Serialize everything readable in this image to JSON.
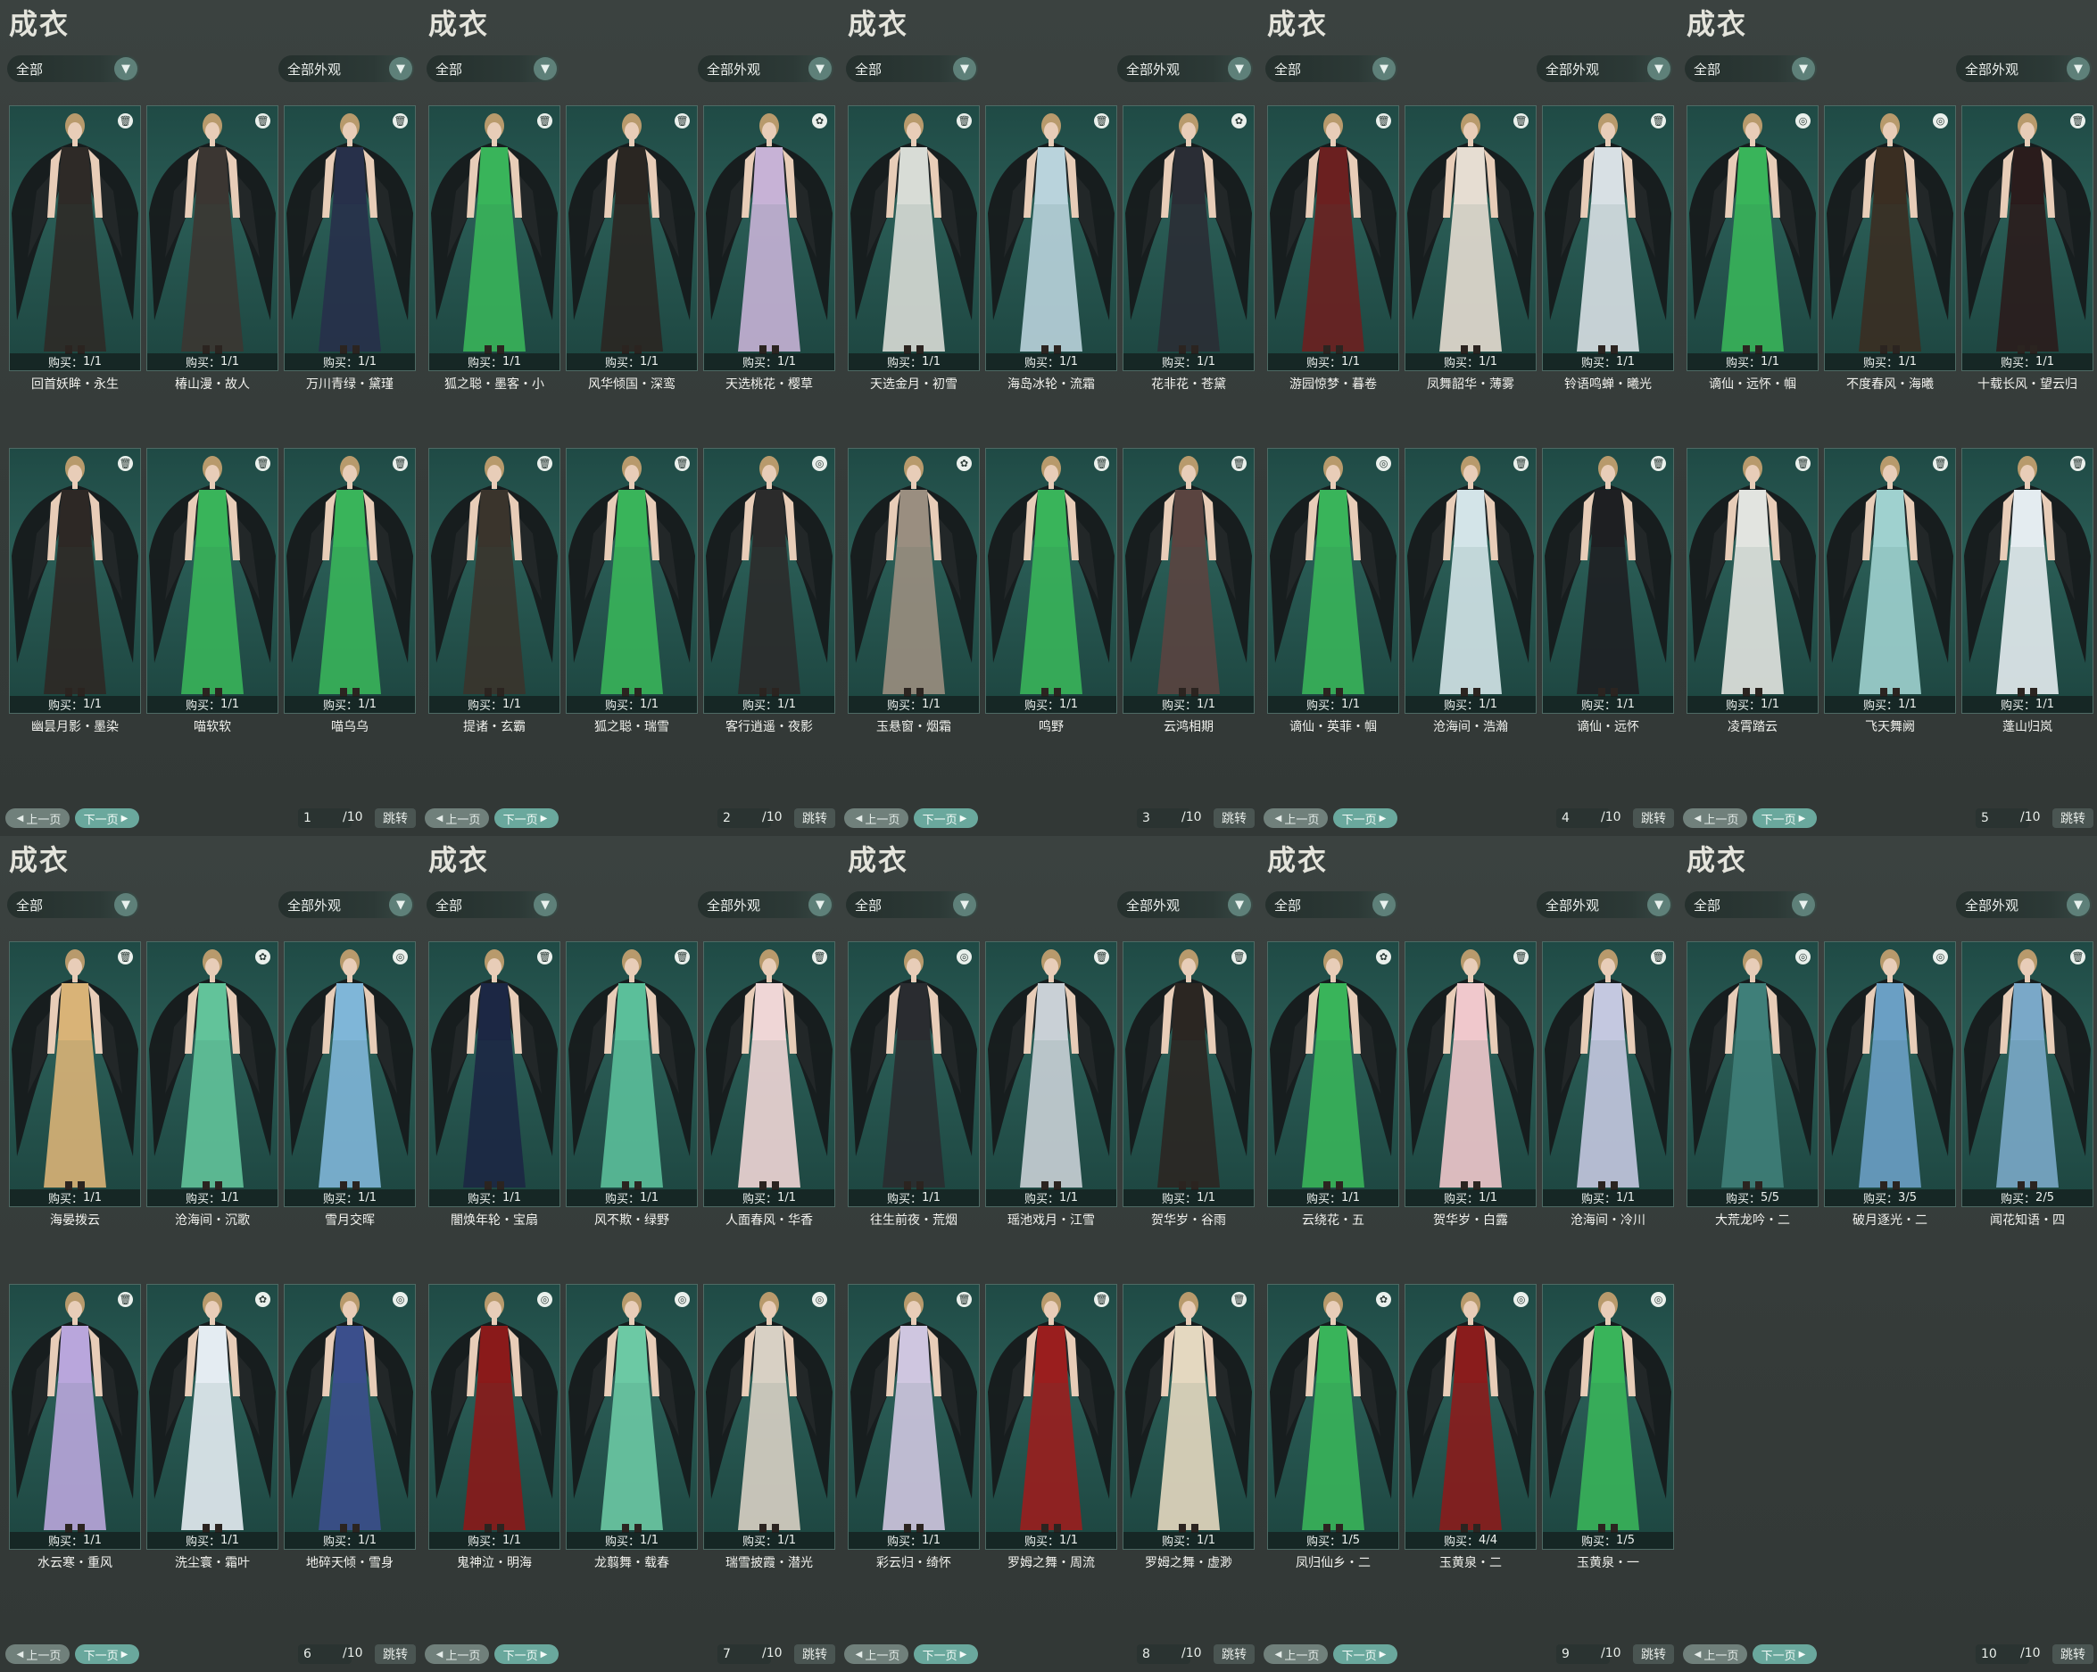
{
  "panel_title": "成衣",
  "filter_left": "全部",
  "filter_right": "全部外观",
  "buy_prefix": "购买：",
  "prev_label": "上一页",
  "next_label": "下一页",
  "jump_label": "跳转",
  "page_total": "/10",
  "icons": {
    "dropdown": "chevron-down-icon",
    "delete": "trash-icon",
    "butterfly": "butterfly-icon",
    "ring": "ring-icon",
    "prev": "arrow-left-icon",
    "next": "arrow-right-icon"
  },
  "colors": {
    "background": "#353c3a",
    "card_bg": "#2a5c55",
    "next_button": "#6aa89d",
    "prev_button": "#70807b",
    "dropdown_chevron": "#5e8079"
  },
  "panels": [
    {
      "page": "1",
      "items": [
        {
          "name": "回首妖眸・永生",
          "buy": "1/1",
          "badge": "delete",
          "outfit": "#2e2a27"
        },
        {
          "name": "椿山漫・故人",
          "buy": "1/1",
          "badge": "delete",
          "outfit": "#3b3632"
        },
        {
          "name": "万川青绿・黛瑾",
          "buy": "1/1",
          "badge": "delete",
          "outfit": "#27304a"
        },
        {
          "name": "幽昙月影・墨染",
          "buy": "1/1",
          "badge": "delete",
          "outfit": "#2d2825"
        },
        {
          "name": "喵软软",
          "buy": "1/1",
          "badge": "delete",
          "outfit": "#39b45a"
        },
        {
          "name": "喵乌乌",
          "buy": "1/1",
          "badge": "delete",
          "outfit": "#39b45a"
        }
      ]
    },
    {
      "page": "2",
      "items": [
        {
          "name": "狐之聪・墨客・小",
          "buy": "1/1",
          "badge": "delete",
          "outfit": "#39b45a"
        },
        {
          "name": "风华倾国・深鸾",
          "buy": "1/1",
          "badge": "delete",
          "outfit": "#2a2622"
        },
        {
          "name": "天选桃花・樱草",
          "buy": "1/1",
          "badge": "butterfly",
          "outfit": "#c7b2d6"
        },
        {
          "name": "提诸・玄霸",
          "buy": "1/1",
          "badge": "delete",
          "outfit": "#3a342c"
        },
        {
          "name": "狐之聪・瑞雪",
          "buy": "1/1",
          "badge": "delete",
          "outfit": "#39b45a"
        },
        {
          "name": "客行逍遥・夜影",
          "buy": "1/1",
          "badge": "ring",
          "outfit": "#2b2b2b"
        }
      ]
    },
    {
      "page": "3",
      "items": [
        {
          "name": "天选金月・初雪",
          "buy": "1/1",
          "badge": "delete",
          "outfit": "#d8dcd6"
        },
        {
          "name": "海岛冰轮・流霜",
          "buy": "1/1",
          "badge": "delete",
          "outfit": "#b9d3dc"
        },
        {
          "name": "花非花・苍黛",
          "buy": "1/1",
          "badge": "butterfly",
          "outfit": "#2a2d35"
        },
        {
          "name": "玉悬窗・烟霜",
          "buy": "1/1",
          "badge": "butterfly",
          "outfit": "#9a8e80"
        },
        {
          "name": "鸣野",
          "buy": "1/1",
          "badge": "delete",
          "outfit": "#39b45a"
        },
        {
          "name": "云鸿相期",
          "buy": "1/1",
          "badge": "delete",
          "outfit": "#5a4440"
        }
      ]
    },
    {
      "page": "4",
      "items": [
        {
          "name": "游园惊梦・暮卷",
          "buy": "1/1",
          "badge": "delete",
          "outfit": "#6b2020"
        },
        {
          "name": "凤舞韶华・薄雾",
          "buy": "1/1",
          "badge": "delete",
          "outfit": "#e6ddd2"
        },
        {
          "name": "铃语鸣蝉・曦光",
          "buy": "1/1",
          "badge": "delete",
          "outfit": "#d8e0e4"
        },
        {
          "name": "谪仙・英菲・帼",
          "buy": "1/1",
          "badge": "ring",
          "outfit": "#39b45a"
        },
        {
          "name": "沧海间・浩瀚",
          "buy": "1/1",
          "badge": "delete",
          "outfit": "#d3e4e8"
        },
        {
          "name": "谪仙・远怀",
          "buy": "1/1",
          "badge": "delete",
          "outfit": "#1e1f22"
        }
      ]
    },
    {
      "page": "5",
      "items": [
        {
          "name": "谪仙・远怀・帼",
          "buy": "1/1",
          "badge": "ring",
          "outfit": "#39b45a"
        },
        {
          "name": "不度春风・海曦",
          "buy": "1/1",
          "badge": "ring",
          "outfit": "#3a2e22"
        },
        {
          "name": "十载长风・望云归",
          "buy": "1/1",
          "badge": "delete",
          "outfit": "#2a1c1c"
        },
        {
          "name": "凌霄踏云",
          "buy": "1/1",
          "badge": "delete",
          "outfit": "#e2e4e0"
        },
        {
          "name": "飞天舞阙",
          "buy": "1/1",
          "badge": "delete",
          "outfit": "#9fd1cf"
        },
        {
          "name": "蓬山归岚",
          "buy": "1/1",
          "badge": "delete",
          "outfit": "#e4ecf0"
        }
      ]
    },
    {
      "page": "6",
      "items": [
        {
          "name": "海晏拨云",
          "buy": "1/1",
          "badge": "delete",
          "outfit": "#d9b377"
        },
        {
          "name": "沧海间・沉歌",
          "buy": "1/1",
          "badge": "butterfly",
          "outfit": "#62c39a"
        },
        {
          "name": "雪月交晖",
          "buy": "1/1",
          "badge": "ring",
          "outfit": "#7fb6d8"
        },
        {
          "name": "水云寒・重风",
          "buy": "1/1",
          "badge": "delete",
          "outfit": "#b9a6dc"
        },
        {
          "name": "洗尘寰・霜叶",
          "buy": "1/1",
          "badge": "butterfly",
          "outfit": "#e4ecf2"
        },
        {
          "name": "地碎天倾・雪身",
          "buy": "1/1",
          "badge": "ring",
          "outfit": "#3b4f8c"
        }
      ]
    },
    {
      "page": "7",
      "items": [
        {
          "name": "闇焕年轮・宝扇",
          "buy": "1/1",
          "badge": "delete",
          "outfit": "#1c2744"
        },
        {
          "name": "风不欺・绿野",
          "buy": "1/1",
          "badge": "delete",
          "outfit": "#5bbf9a"
        },
        {
          "name": "人面春风・华香",
          "buy": "1/1",
          "badge": "delete",
          "outfit": "#efd6d6"
        },
        {
          "name": "鬼神泣・明海",
          "buy": "1/1",
          "badge": "ring",
          "outfit": "#8a1a1a"
        },
        {
          "name": "龙翦舞・载春",
          "buy": "1/1",
          "badge": "ring",
          "outfit": "#6cc9a4"
        },
        {
          "name": "瑞雪披霞・潜光",
          "buy": "1/1",
          "badge": "ring",
          "outfit": "#d8d0c4"
        }
      ]
    },
    {
      "page": "8",
      "items": [
        {
          "name": "往生前夜・荒烟",
          "buy": "1/1",
          "badge": "ring",
          "outfit": "#2a2c30"
        },
        {
          "name": "瑶池戏月・江雪",
          "buy": "1/1",
          "badge": "delete",
          "outfit": "#c9d0d6"
        },
        {
          "name": "贺华岁・谷雨",
          "buy": "1/1",
          "badge": "delete",
          "outfit": "#2b2622"
        },
        {
          "name": "彩云归・绮怀",
          "buy": "1/1",
          "badge": "delete",
          "outfit": "#cfc6e0"
        },
        {
          "name": "罗姆之舞・周流",
          "buy": "1/1",
          "badge": "delete",
          "outfit": "#9a1e1e"
        },
        {
          "name": "罗姆之舞・虚渺",
          "buy": "1/1",
          "badge": "delete",
          "outfit": "#e4d8c0"
        }
      ]
    },
    {
      "page": "9",
      "items": [
        {
          "name": "云绕花・五",
          "buy": "1/1",
          "badge": "butterfly",
          "outfit": "#39b45a"
        },
        {
          "name": "贺华岁・白露",
          "buy": "1/1",
          "badge": "delete",
          "outfit": "#f0c8cc"
        },
        {
          "name": "沧海间・冷川",
          "buy": "1/1",
          "badge": "delete",
          "outfit": "#c4c8e0"
        },
        {
          "name": "凤归仙乡・二",
          "buy": "1/5",
          "badge": "butterfly",
          "outfit": "#39b45a"
        },
        {
          "name": "玉黄泉・二",
          "buy": "4/4",
          "badge": "ring",
          "outfit": "#8a1c1c"
        },
        {
          "name": "玉黄泉・一",
          "buy": "1/5",
          "badge": "ring",
          "outfit": "#39b45a"
        }
      ]
    },
    {
      "page": "10",
      "items": [
        {
          "name": "大荒龙吟・二",
          "buy": "5/5",
          "badge": "ring",
          "outfit": "#3f7f79"
        },
        {
          "name": "破月逐光・二",
          "buy": "3/5",
          "badge": "ring",
          "outfit": "#6a9fc4"
        },
        {
          "name": "闻花知语・四",
          "buy": "2/5",
          "badge": "delete",
          "outfit": "#7aa8c8"
        }
      ]
    }
  ]
}
